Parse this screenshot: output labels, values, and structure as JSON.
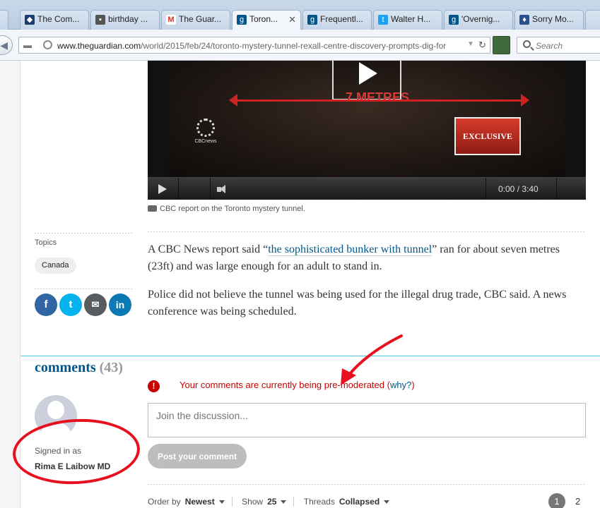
{
  "browser": {
    "tabs": [
      {
        "label": "The Com...",
        "icon": "shield-icon",
        "color": "#1a3c6e"
      },
      {
        "label": "birthday ...",
        "icon": "page-icon",
        "color": "#555555"
      },
      {
        "label": "The Guar...",
        "icon": "gmail-icon",
        "color": "#d93025"
      },
      {
        "label": "Toron...",
        "icon": "guardian-icon",
        "color": "#005689",
        "active": true
      },
      {
        "label": "Frequentl...",
        "icon": "guardian-icon",
        "color": "#005689"
      },
      {
        "label": "Walter H...",
        "icon": "twitter-icon",
        "color": "#1da1f2"
      },
      {
        "label": "'Overnig...",
        "icon": "guardian-icon",
        "color": "#005689"
      },
      {
        "label": "Sorry Mo...",
        "icon": "bookmark-icon",
        "color": "#2b4f8c"
      }
    ],
    "url_domain": "www.theguardian.com",
    "url_path": "/world/2015/feb/24/toronto-mystery-tunnel-rexall-centre-discovery-prompts-dig-for",
    "search_placeholder": "Search"
  },
  "video": {
    "overlay_text": "7 METRES",
    "logo_text": "CBCnews",
    "badge_text": "EXCLUSIVE",
    "time": "0:00 / 3:40",
    "caption": "CBC report on the Toronto mystery tunnel."
  },
  "sidebar": {
    "topics_label": "Topics",
    "topic": "Canada",
    "share": {
      "facebook": "f",
      "twitter": "t",
      "email": "✉",
      "linkedin": "in"
    }
  },
  "article": {
    "p1_before": "A CBC News report said “",
    "p1_link": "the sophisticated bunker with tunnel",
    "p1_after": "” ran for about seven metres (23ft) and was large enough for an adult to stand in.",
    "p2": "Police did not believe the tunnel was being used for the illegal drug trade, CBC said. A news conference was being scheduled."
  },
  "comments": {
    "title": "comments",
    "count": "(43)",
    "premod_text": "Your comments are currently being pre-moderated (",
    "premod_link": "why?",
    "premod_close": ")",
    "placeholder": "Join the discussion...",
    "post_label": "Post your comment",
    "signed_in_label": "Signed in as",
    "user_name": "Rima E Laibow MD",
    "order_label": "Order by",
    "order_value": "Newest",
    "show_label": "Show",
    "show_value": "25",
    "threads_label": "Threads",
    "threads_value": "Collapsed",
    "page_current": "1",
    "page_next": "2"
  },
  "colors": {
    "annotation": "#e8101e",
    "link": "#005689",
    "accent_rule": "#4bc6df"
  }
}
